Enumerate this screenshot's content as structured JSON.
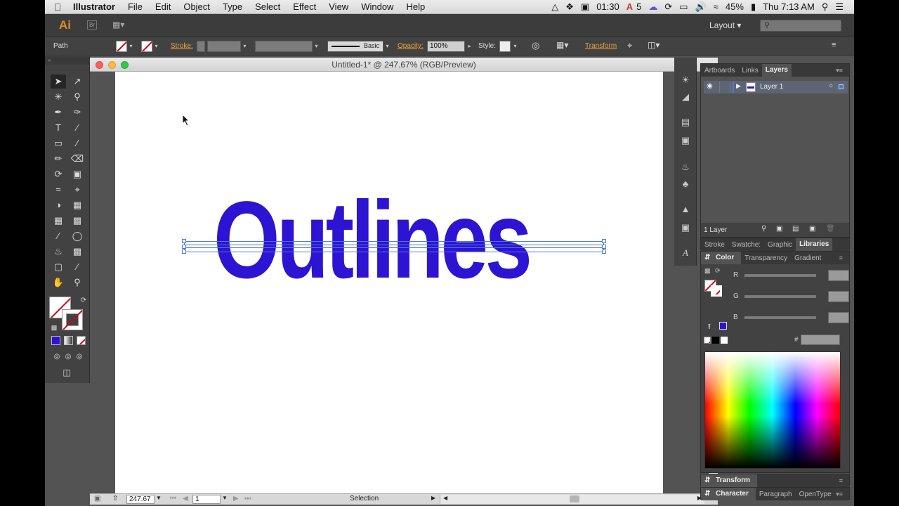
{
  "menubar": {
    "items": [
      "Illustrator",
      "File",
      "Edit",
      "Object",
      "Type",
      "Select",
      "Effect",
      "View",
      "Window",
      "Help"
    ],
    "status": {
      "timer": "01:30",
      "adobe_count": "5",
      "battery": "45%",
      "clock": "Thu 7:13 AM"
    }
  },
  "appbar": {
    "logo": "Ai",
    "workspace": "Layout",
    "search_placeholder": ""
  },
  "controlbar": {
    "selection_type": "Path",
    "stroke_label": "Stroke:",
    "brush_label": "Basic",
    "opacity_label": "Opacity:",
    "opacity_value": "100%",
    "style_label": "Style:",
    "transform_label": "Transform"
  },
  "document": {
    "title": "Untitled-1* @ 247.67% (RGB/Preview)",
    "artwork_text": "Outlines",
    "artwork_color": "#2d14d2",
    "zoom": "247.67",
    "artboard_number": "1",
    "status_text": "Selection"
  },
  "layers_panel": {
    "tabs": [
      "Artboards",
      "Links",
      "Layers"
    ],
    "active_tab": "Layers",
    "layer_name": "Layer 1",
    "footer_count": "1 Layer"
  },
  "swatches_tabs": [
    "Stroke",
    "Swatche:",
    "Graphic",
    "Libraries"
  ],
  "color_panel": {
    "tabs": [
      "Color",
      "Transparency",
      "Gradient"
    ],
    "channels": [
      "R",
      "G",
      "B"
    ],
    "hex_prefix": "#"
  },
  "transform_panel": {
    "tabs": [
      "Transform"
    ]
  },
  "character_panel": {
    "tabs": [
      "Character",
      "Paragraph",
      "OpenType"
    ]
  },
  "colors": {
    "accent_orange": "#e8a33a",
    "fill_blue": "#2d14d2",
    "none_red": "#d0021b",
    "selection_blue": "#4a78e0"
  }
}
